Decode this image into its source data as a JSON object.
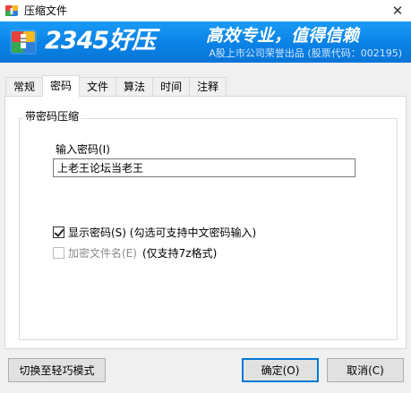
{
  "window": {
    "title": "压缩文件",
    "close_glyph": "✕"
  },
  "banner": {
    "logo_text": "2345好压",
    "slogan": "高效专业，值得信赖",
    "subtitle": "A股上市公司荣誉出品 (股票代码：002195)",
    "colors": {
      "background": "#0a82e6",
      "text": "#ffffff"
    }
  },
  "tabs": [
    {
      "label": "常规",
      "active": false
    },
    {
      "label": "密码",
      "active": true
    },
    {
      "label": "文件",
      "active": false
    },
    {
      "label": "算法",
      "active": false
    },
    {
      "label": "时间",
      "active": false
    },
    {
      "label": "注释",
      "active": false
    }
  ],
  "password_panel": {
    "group_title": "带密码压缩",
    "input_label": "输入密码(I)",
    "input_value": "上老王论坛当老王",
    "show_password": {
      "label": "显示密码(S)  (勾选可支持中文密码输入)",
      "checked": true,
      "enabled": true
    },
    "encrypt_filenames": {
      "label": "加密文件名(E)",
      "note": "(仅支持7z格式)",
      "checked": false,
      "enabled": false
    }
  },
  "buttons": {
    "switch_mode": "切换至轻巧模式",
    "ok": "确定(O)",
    "cancel": "取消(C)"
  },
  "icons": {
    "app": "archive-icon",
    "close": "close-icon",
    "logo": "archive-logo-icon"
  }
}
